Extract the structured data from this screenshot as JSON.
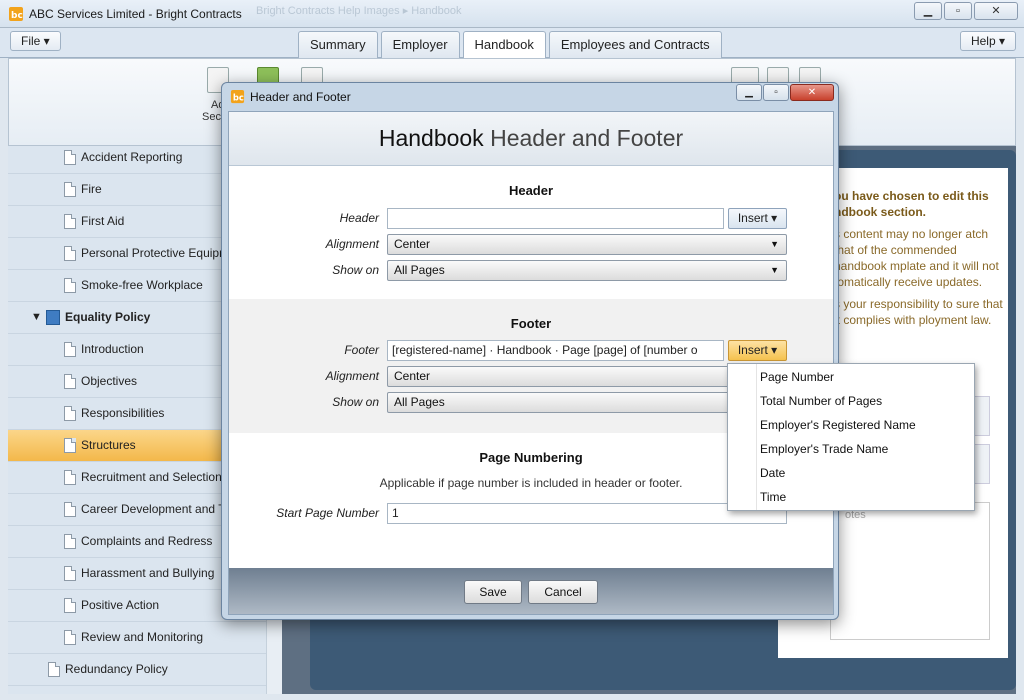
{
  "window": {
    "title": "ABC Services Limited - Bright Contracts",
    "ghost_title": "Bright Contracts Help Images  ▸  Handbook"
  },
  "menubar": {
    "file": "File ▾",
    "help": "Help ▾",
    "tabs": [
      "Summary",
      "Employer",
      "Handbook",
      "Employees and Contracts"
    ],
    "active_tab": "Handbook"
  },
  "ribbon": {
    "label_1": "Ad",
    "label_2": "Sec"
  },
  "sidebar": {
    "items": [
      {
        "label": "Accident Reporting"
      },
      {
        "label": "Fire"
      },
      {
        "label": "First Aid"
      },
      {
        "label": "Personal Protective Equipment"
      },
      {
        "label": "Smoke-free Workplace"
      },
      {
        "label": "Equality Policy"
      },
      {
        "label": "Introduction"
      },
      {
        "label": "Objectives"
      },
      {
        "label": "Responsibilities"
      },
      {
        "label": "Structures"
      },
      {
        "label": "Recruitment and Selection"
      },
      {
        "label": "Career Development and Training"
      },
      {
        "label": "Complaints and Redress"
      },
      {
        "label": "Harassment and Bullying"
      },
      {
        "label": "Positive Action"
      },
      {
        "label": "Review and Monitoring"
      },
      {
        "label": "Redundancy Policy"
      }
    ]
  },
  "notice": {
    "heading": "ou have chosen to edit this ndbook section.",
    "p1": "s content may no longer atch that of the commended handbook mplate and it will not tomatically receive updates.",
    "p2": "s your responsibility to sure that it complies with ployment law.",
    "notes_placeholder": "otes"
  },
  "dialog": {
    "title": "Header and Footer",
    "heading_bold": "Handbook",
    "heading_rest": "Header and Footer",
    "header": {
      "section_title": "Header",
      "header_label": "Header",
      "header_value": "",
      "insert_label": "Insert ▾",
      "alignment_label": "Alignment",
      "alignment_value": "Center",
      "show_on_label": "Show on",
      "show_on_value": "All Pages"
    },
    "footer": {
      "section_title": "Footer",
      "footer_label": "Footer",
      "footer_value": "[registered-name]  ·  Handbook  ·  Page [page] of [number o",
      "insert_label": "Insert ▾",
      "alignment_label": "Alignment",
      "alignment_value": "Center",
      "show_on_label": "Show on",
      "show_on_value": "All Pages"
    },
    "page_numbering": {
      "section_title": "Page Numbering",
      "note": "Applicable if page number is included in header or footer.",
      "start_label": "Start Page Number",
      "start_value": "1"
    },
    "buttons": {
      "save": "Save",
      "cancel": "Cancel"
    }
  },
  "insert_menu": {
    "items": [
      "Page Number",
      "Total Number of Pages",
      "Employer's Registered Name",
      "Employer's Trade Name",
      "Date",
      "Time"
    ]
  },
  "colors": {
    "accent": "#f3b84a",
    "selection": "#fbd68a"
  }
}
